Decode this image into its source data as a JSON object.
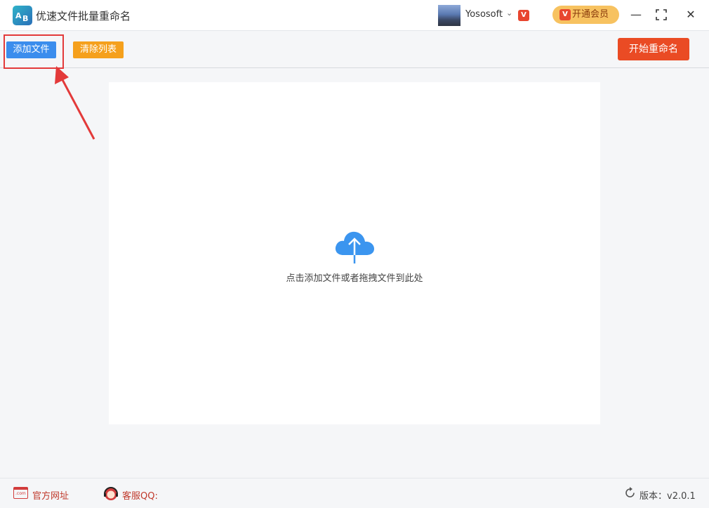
{
  "titlebar": {
    "title": "优速文件批量重命名",
    "logo_text_a": "A",
    "logo_text_b": "B",
    "username": "Yososoft",
    "vip_badge": "V",
    "open_vip_label": "开通会员",
    "minimize": "—",
    "maximize": "⛶",
    "close": "✕"
  },
  "toolbar": {
    "add_files_label": "添加文件",
    "clear_list_label": "清除列表",
    "start_rename_label": "开始重命名"
  },
  "dropzone": {
    "hint": "点击添加文件或者拖拽文件到此处"
  },
  "footer": {
    "web_icon_text": ".com",
    "site_label": "官方网址",
    "qq_label": "客服QQ:",
    "version": "版本：v2.0.1"
  },
  "colors": {
    "accent_blue": "#3b8ded",
    "accent_orange": "#f5a01c",
    "start_red": "#ea4b24",
    "vip_gold": "#f7c260",
    "highlight_red": "#e33a3a"
  }
}
